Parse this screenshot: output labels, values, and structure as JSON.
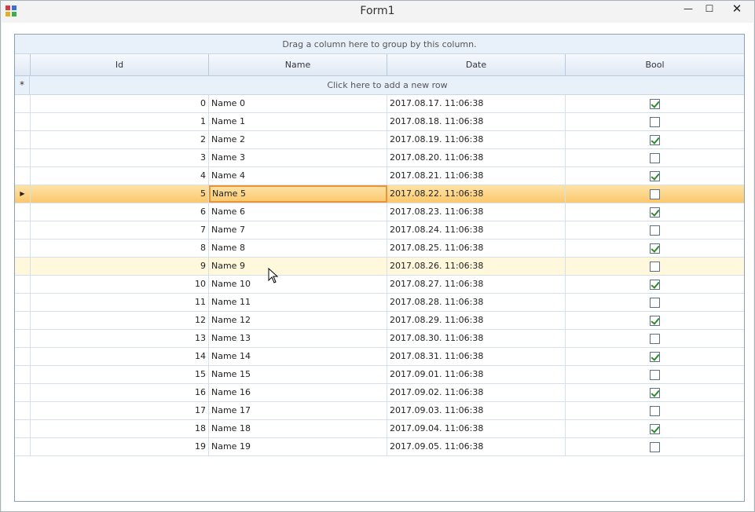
{
  "window": {
    "title": "Form1",
    "minimize_glyph": "—",
    "maximize_glyph": "☐",
    "close_glyph": "✕"
  },
  "grid": {
    "group_panel_text": "Drag a column here to group by this column.",
    "columns": [
      {
        "key": "id",
        "label": "Id"
      },
      {
        "key": "name",
        "label": "Name"
      },
      {
        "key": "date",
        "label": "Date"
      },
      {
        "key": "bool",
        "label": "Bool"
      }
    ],
    "new_row": {
      "indicator": "*",
      "text": "Click here to add a new row"
    },
    "current_row_index": 5,
    "hover_row_index": 9,
    "current_row_indicator": "▶",
    "rows": [
      {
        "id": "0",
        "name": "Name 0",
        "date": "2017.08.17. 11:06:38",
        "bool": true
      },
      {
        "id": "1",
        "name": "Name 1",
        "date": "2017.08.18. 11:06:38",
        "bool": false
      },
      {
        "id": "2",
        "name": "Name 2",
        "date": "2017.08.19. 11:06:38",
        "bool": true
      },
      {
        "id": "3",
        "name": "Name 3",
        "date": "2017.08.20. 11:06:38",
        "bool": false
      },
      {
        "id": "4",
        "name": "Name 4",
        "date": "2017.08.21. 11:06:38",
        "bool": true
      },
      {
        "id": "5",
        "name": "Name 5",
        "date": "2017.08.22. 11:06:38",
        "bool": false
      },
      {
        "id": "6",
        "name": "Name 6",
        "date": "2017.08.23. 11:06:38",
        "bool": true
      },
      {
        "id": "7",
        "name": "Name 7",
        "date": "2017.08.24. 11:06:38",
        "bool": false
      },
      {
        "id": "8",
        "name": "Name 8",
        "date": "2017.08.25. 11:06:38",
        "bool": true
      },
      {
        "id": "9",
        "name": "Name 9",
        "date": "2017.08.26. 11:06:38",
        "bool": false
      },
      {
        "id": "10",
        "name": "Name 10",
        "date": "2017.08.27. 11:06:38",
        "bool": true
      },
      {
        "id": "11",
        "name": "Name 11",
        "date": "2017.08.28. 11:06:38",
        "bool": false
      },
      {
        "id": "12",
        "name": "Name 12",
        "date": "2017.08.29. 11:06:38",
        "bool": true
      },
      {
        "id": "13",
        "name": "Name 13",
        "date": "2017.08.30. 11:06:38",
        "bool": false
      },
      {
        "id": "14",
        "name": "Name 14",
        "date": "2017.08.31. 11:06:38",
        "bool": true
      },
      {
        "id": "15",
        "name": "Name 15",
        "date": "2017.09.01. 11:06:38",
        "bool": false
      },
      {
        "id": "16",
        "name": "Name 16",
        "date": "2017.09.02. 11:06:38",
        "bool": true
      },
      {
        "id": "17",
        "name": "Name 17",
        "date": "2017.09.03. 11:06:38",
        "bool": false
      },
      {
        "id": "18",
        "name": "Name 18",
        "date": "2017.09.04. 11:06:38",
        "bool": true
      },
      {
        "id": "19",
        "name": "Name 19",
        "date": "2017.09.05. 11:06:38",
        "bool": false
      }
    ]
  },
  "colors": {
    "accent_border": "#e8953a",
    "current_row": "#fbc86c",
    "hover_row": "#fff8dc",
    "header_bg": "#dfe8f4",
    "check_mark": "#2f8a2f"
  }
}
